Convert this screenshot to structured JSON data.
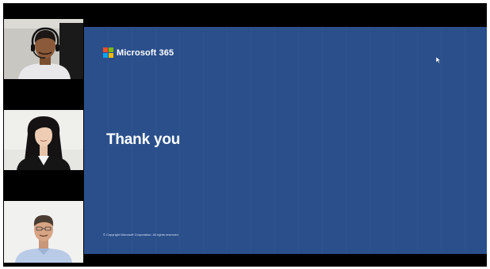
{
  "meeting": {
    "participants": [
      {
        "tile_id": "participant-1",
        "headset": true
      },
      {
        "tile_id": "participant-2",
        "headset": false
      },
      {
        "tile_id": "participant-3",
        "headset": false
      }
    ]
  },
  "slide": {
    "brand_name": "Microsoft 365",
    "title": "Thank you",
    "copyright": "© Copyright Microsoft Corporation. All rights reserved.",
    "background_color": "#2a4f8b"
  },
  "colors": {
    "logo_red": "#f25022",
    "logo_green": "#7fba00",
    "logo_blue": "#00a4ef",
    "logo_yellow": "#ffb900"
  },
  "icons": {
    "logo": "microsoft-logo-icon",
    "cursor": "mouse-pointer-icon"
  }
}
